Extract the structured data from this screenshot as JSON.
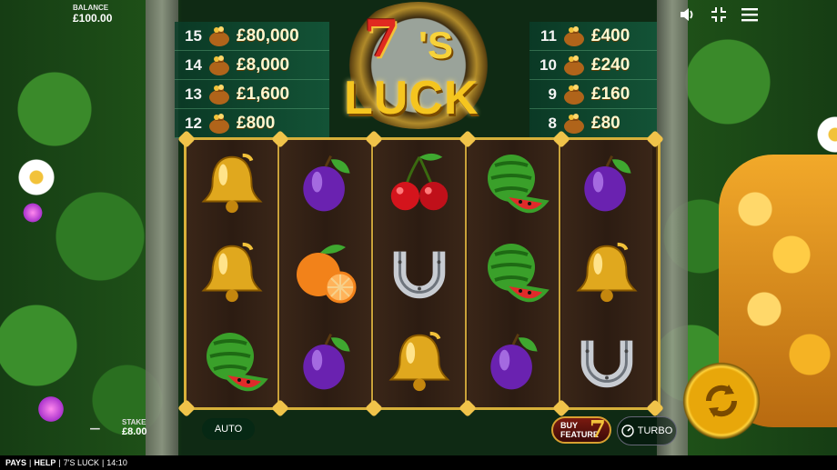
{
  "balance": {
    "label": "BALANCE",
    "value": "£100.00"
  },
  "logo": {
    "seven": "7",
    "s": "'S",
    "luck": "LUCK"
  },
  "paytable_left": [
    {
      "count": "15",
      "prize": "£80,000"
    },
    {
      "count": "14",
      "prize": "£8,000"
    },
    {
      "count": "13",
      "prize": "£1,600"
    },
    {
      "count": "12",
      "prize": "£800"
    }
  ],
  "paytable_right": [
    {
      "count": "11",
      "prize": "£400"
    },
    {
      "count": "10",
      "prize": "£240"
    },
    {
      "count": "9",
      "prize": "£160"
    },
    {
      "count": "8",
      "prize": "£80"
    }
  ],
  "reels": [
    [
      "bell",
      "bell",
      "watermelon"
    ],
    [
      "plum",
      "orange",
      "plum"
    ],
    [
      "cherry",
      "horseshoe",
      "bell"
    ],
    [
      "watermelon",
      "watermelon",
      "plum"
    ],
    [
      "plum",
      "bell",
      "horseshoe"
    ]
  ],
  "controls": {
    "minus": "−",
    "stake_label": "STAKE",
    "stake_value": "£8.00",
    "auto": "AUTO",
    "buy_line1": "BUY",
    "buy_line2": "FEATURE",
    "buy_7": "7",
    "turbo": "TURBO"
  },
  "footer": {
    "pays": "PAYS",
    "help": "HELP",
    "game": "7'S LUCK",
    "time": "14:10"
  },
  "colors": {
    "gold": "#d7b03a",
    "reel_bg": "#2c1c12",
    "spin": "#e8a70a"
  }
}
